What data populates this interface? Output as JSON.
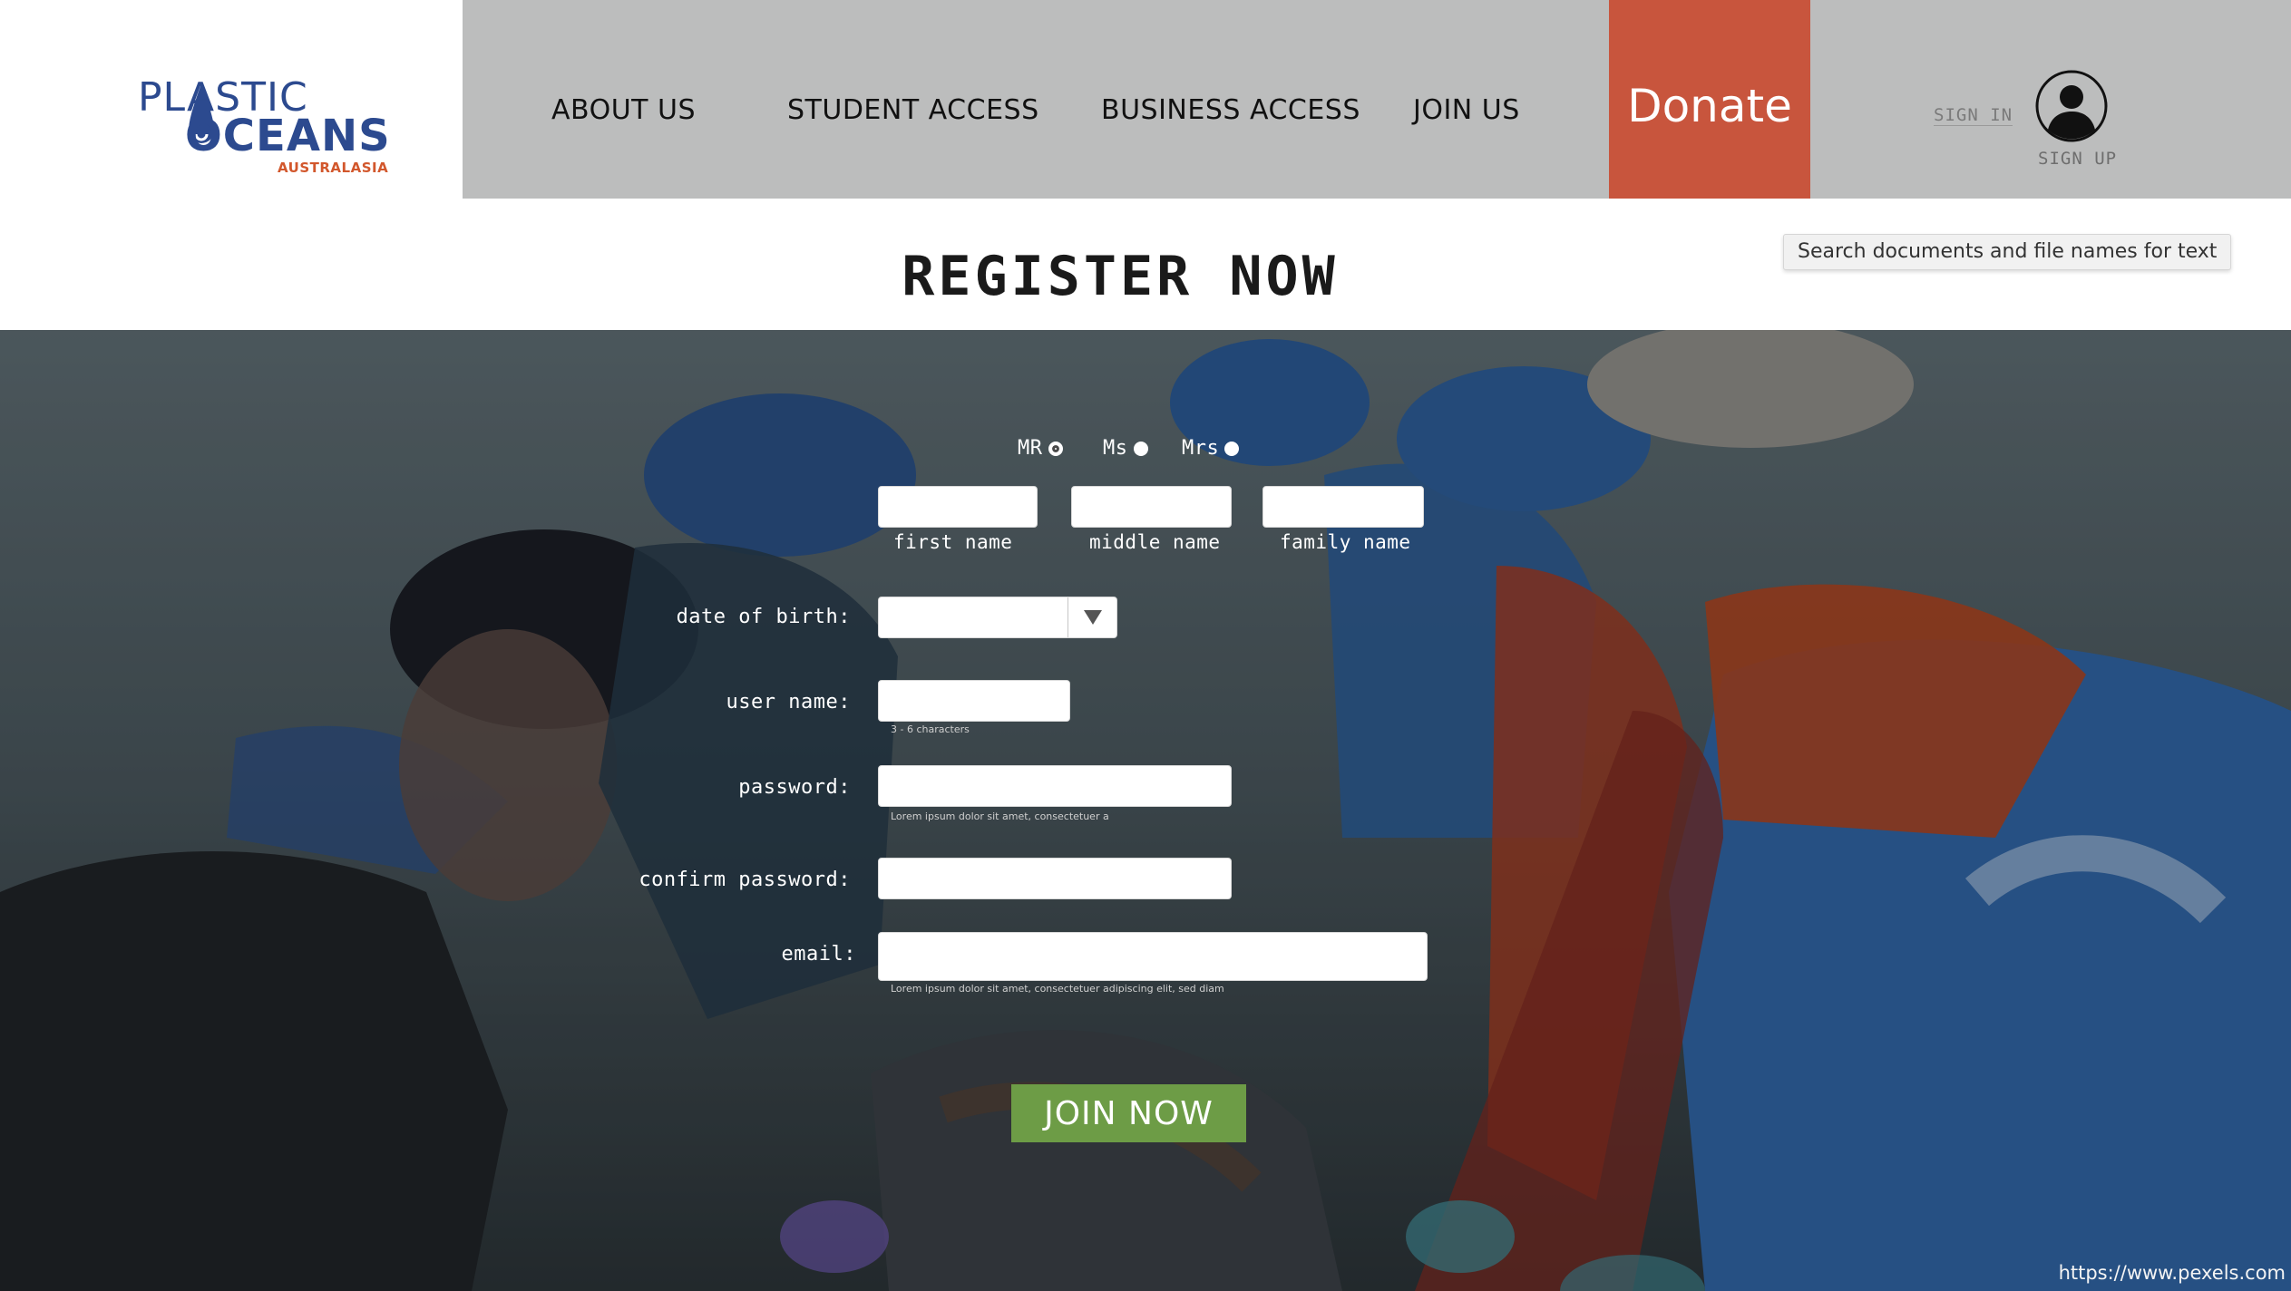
{
  "brand": {
    "logo_top": "PLASTIC",
    "logo_main": "OCEANS",
    "logo_sub": "AUSTRALASIA",
    "colors": {
      "blue": "#2c4a8f",
      "orange": "#d2572c"
    }
  },
  "nav": {
    "items": [
      {
        "label": "ABOUT US"
      },
      {
        "label": "STUDENT ACCESS"
      },
      {
        "label": "BUSINESS ACCESS"
      },
      {
        "label": "JOIN US"
      }
    ],
    "donate_label": "Donate",
    "donate_color": "#c8553d",
    "bar_color": "#bcbdbd",
    "sign_in": "SIGN IN",
    "sign_up": "SIGN UP",
    "avatar_icon": "user-circle-icon"
  },
  "page": {
    "title": "REGISTER NOW",
    "search_tooltip": "Search documents and file names for text",
    "photo_credit": "https://www.pexels.com"
  },
  "form": {
    "salutations": [
      {
        "label": "MR",
        "selected": true
      },
      {
        "label": "Ms",
        "selected": false
      },
      {
        "label": "Mrs",
        "selected": false
      }
    ],
    "name_fields": {
      "first": "first name",
      "middle": "middle name",
      "family": "family name"
    },
    "dob_label": "date of birth:",
    "dob_value": "",
    "username_label": "user name:",
    "username_hint": "3 - 6 characters",
    "password_label": "password:",
    "password_hint": "Lorem ipsum dolor sit amet, consectetuer a",
    "confirm_label": "confirm password:",
    "email_label": "email:",
    "email_hint": "Lorem ipsum dolor sit amet, consectetuer adipiscing elit, sed diam",
    "submit_label": "JOIN NOW",
    "submit_color": "#6d9c46"
  }
}
